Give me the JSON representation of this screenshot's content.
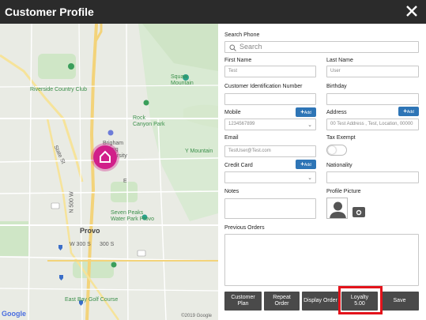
{
  "window": {
    "title": "Customer Profile",
    "close_icon": "close-icon"
  },
  "map": {
    "labels": {
      "squaw": "Squaw\nMountain",
      "riverside": "Riverside Country Club",
      "rock_canyon": "Rock\nCanyon Park",
      "byu": "Brigham\nYoung\nUniversity",
      "y_mountain": "Y Mountain",
      "state_st": "State St",
      "n_500w": "N 500 W",
      "seven_peaks": "Seven Peaks\nWater Park Provo",
      "provo": "Provo",
      "w300s": "W 300 S",
      "s300s": "300 S",
      "east_bay": "East Bay Golf Course",
      "e_label": "E"
    },
    "google": "Google",
    "copyright": "©2019 Google"
  },
  "form": {
    "search_phone_label": "Search Phone",
    "search_placeholder": "Search",
    "first_name_label": "First Name",
    "first_name_value": "Test",
    "last_name_label": "Last Name",
    "last_name_value": "User",
    "cust_id_label": "Customer Identification Number",
    "birthday_label": "Birthday",
    "mobile_label": "Mobile",
    "mobile_value": "1234567899",
    "address_label": "Address",
    "address_value": "00 Test Address , Test, Location, 00000",
    "add_label": "Add",
    "email_label": "Email",
    "email_value": "TestUser@Test.com",
    "tax_exempt_label": "Tax Exempt",
    "credit_card_label": "Credit Card",
    "nationality_label": "Nationality",
    "notes_label": "Notes",
    "profile_picture_label": "Profile Picture",
    "previous_orders_label": "Previous Orders"
  },
  "buttons": {
    "customer_plan": "Customer\nPlan",
    "repeat_order": "Repeat\nOrder",
    "display_order": "Display Order",
    "loyalty_title": "Loyalty",
    "loyalty_value": "5.00",
    "save": "Save"
  },
  "colors": {
    "accent": "#2e75b6",
    "highlight": "#e3131b",
    "pin": "#d11f8a",
    "titlebar": "#2b2b2b",
    "button": "#4a4a4a"
  }
}
